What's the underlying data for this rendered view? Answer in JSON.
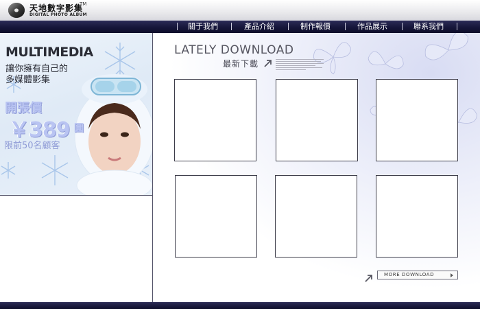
{
  "header": {
    "brand_cn": "天地數字影集",
    "brand_tm": "TM",
    "brand_en": "DIGITAL PHOTO ALBUM",
    "logo_icon": "disc-logo-icon"
  },
  "nav": {
    "items": [
      {
        "label": "關于我們"
      },
      {
        "label": "產品介紹"
      },
      {
        "label": "制作報價"
      },
      {
        "label": "作品展示"
      },
      {
        "label": "聯系我們"
      }
    ]
  },
  "promo": {
    "title": "MULTIMEDIA",
    "subtitle_line1": "讓你擁有自己的",
    "subtitle_line2": "多媒體影集",
    "price_label": "開張價",
    "price": "￥389",
    "price_unit": "圓",
    "limit_text": "限前50名顧客"
  },
  "main": {
    "heading_en": "LATELY DOWNLOAD",
    "heading_cn": "最新下載",
    "thumbnails_count_label": "",
    "more_button": "MORE DOWNLOAD"
  },
  "colors": {
    "nav_bg": "#16163a",
    "promo_price": "#b9c4f2",
    "border": "#3d3d4a"
  }
}
